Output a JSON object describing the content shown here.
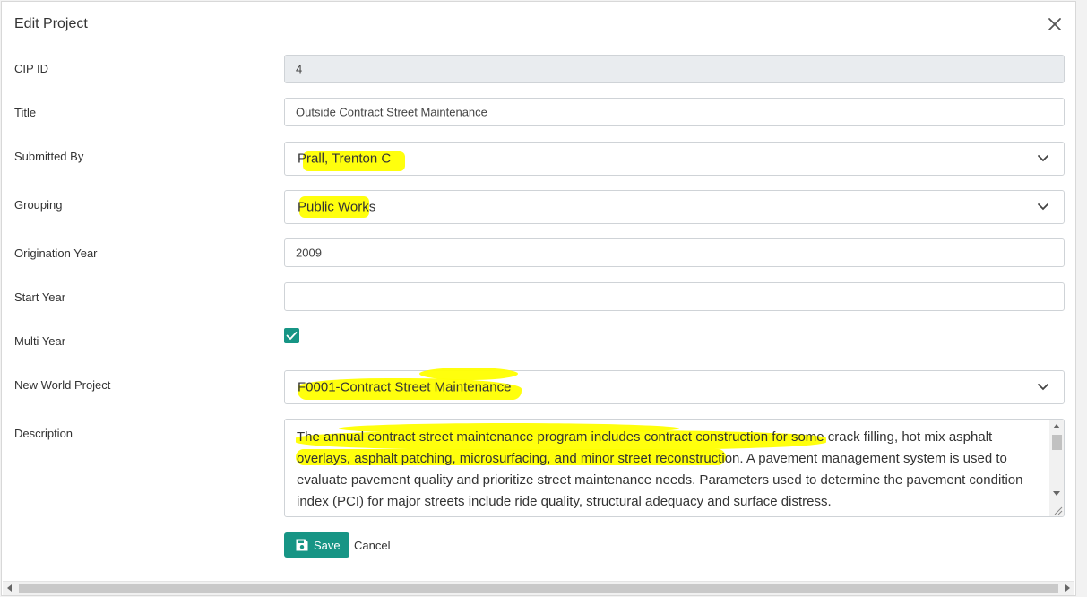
{
  "dialog": {
    "title": "Edit Project"
  },
  "fields": {
    "cip_id": {
      "label": "CIP ID",
      "value": "4"
    },
    "title": {
      "label": "Title",
      "value": "Outside Contract Street Maintenance"
    },
    "submitted_by": {
      "label": "Submitted By",
      "value": "Prall, Trenton C"
    },
    "grouping": {
      "label": "Grouping",
      "value": "Public Works"
    },
    "origination_year": {
      "label": "Origination Year",
      "value": "2009"
    },
    "start_year": {
      "label": "Start Year",
      "value": ""
    },
    "multi_year": {
      "label": "Multi Year",
      "checked": true
    },
    "new_world_project": {
      "label": "New World Project",
      "value": "F0001-Contract Street Maintenance"
    },
    "description": {
      "label": "Description",
      "value": "The annual contract street maintenance program includes contract construction for some crack filling, hot mix asphalt overlays, asphalt patching, microsurfacing, and minor street reconstruction.  A pavement management system is used to evaluate pavement quality and  prioritize street maintenance needs. Parameters used to determine the pavement condition index (PCI) for major streets include ride quality, structural adequacy and surface distress."
    }
  },
  "actions": {
    "save_label": "Save",
    "cancel_label": "Cancel"
  },
  "colors": {
    "accent": "#179585",
    "highlight": "#ffff00",
    "readonly_bg": "#e9ecef"
  },
  "icons": {
    "close": "close-icon",
    "chevron": "chevron-down-icon",
    "save": "floppy-disk-icon",
    "check": "check-icon"
  }
}
